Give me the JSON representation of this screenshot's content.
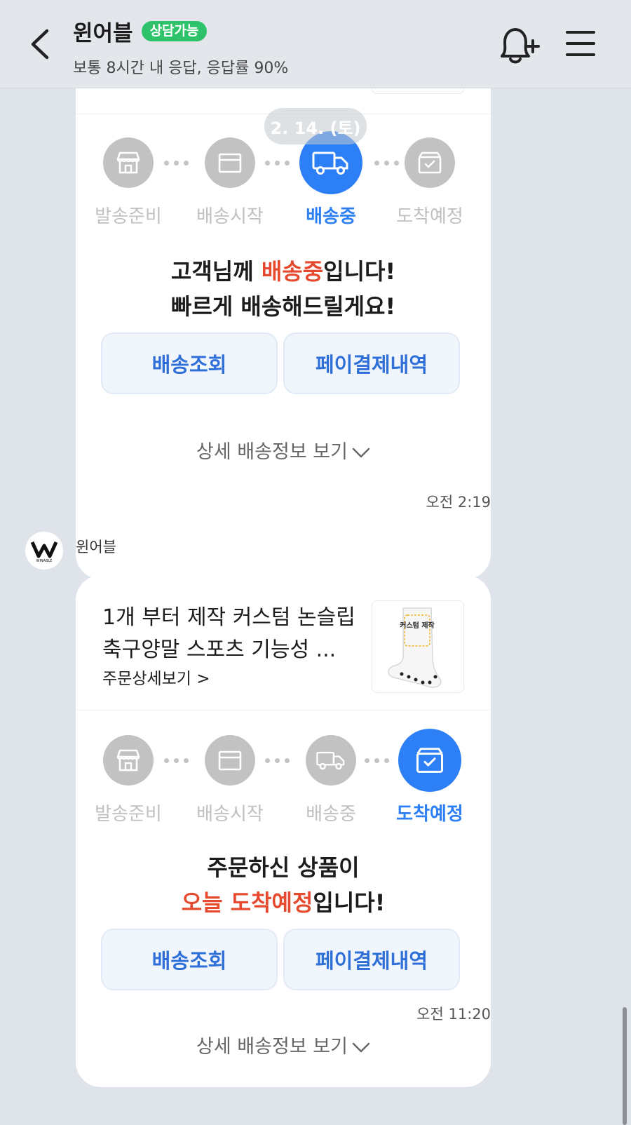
{
  "header": {
    "title": "윈어블",
    "badge": "상담가능",
    "subtitle": "보통 8시간 내 응답, 응답률 90%"
  },
  "date_pill": "2. 14. (토)",
  "cards": [
    {
      "steps": [
        "발송준비",
        "배송시작",
        "배송중",
        "도착예정"
      ],
      "active_step": "배송중",
      "message": {
        "line1_pre": "고객님께 ",
        "line1_red": "배송중",
        "line1_post": "입니다!",
        "line2": "빠르게 배송해드릴게요!"
      },
      "buttons": [
        "배송조회",
        "페이결제내역"
      ],
      "detail": "상세 배송정보 보기",
      "time": "오전 2:19"
    },
    {
      "sender": "윈어블",
      "avatar_text": "WINABLE",
      "product": {
        "title": "1개 부터 제작 커스텀 논슬립 축구양말 스포츠 기능성 ...",
        "order_link": "주문상세보기 >",
        "sticker_text": "커스텀 제작"
      },
      "steps": [
        "발송준비",
        "배송시작",
        "배송중",
        "도착예정"
      ],
      "active_step": "도착예정",
      "message": {
        "line1": "주문하신 상품이",
        "line2_red": "오늘 도착예정",
        "line2_post": "입니다!"
      },
      "buttons": [
        "배송조회",
        "페이결제내역"
      ],
      "detail": "상세 배송정보 보기",
      "time": "오전 11:20"
    }
  ],
  "colors": {
    "accent_blue": "#2d7ff6",
    "highlight_red": "#e64a2e",
    "badge_green": "#2ec26a",
    "button_text": "#2f6fd8"
  }
}
